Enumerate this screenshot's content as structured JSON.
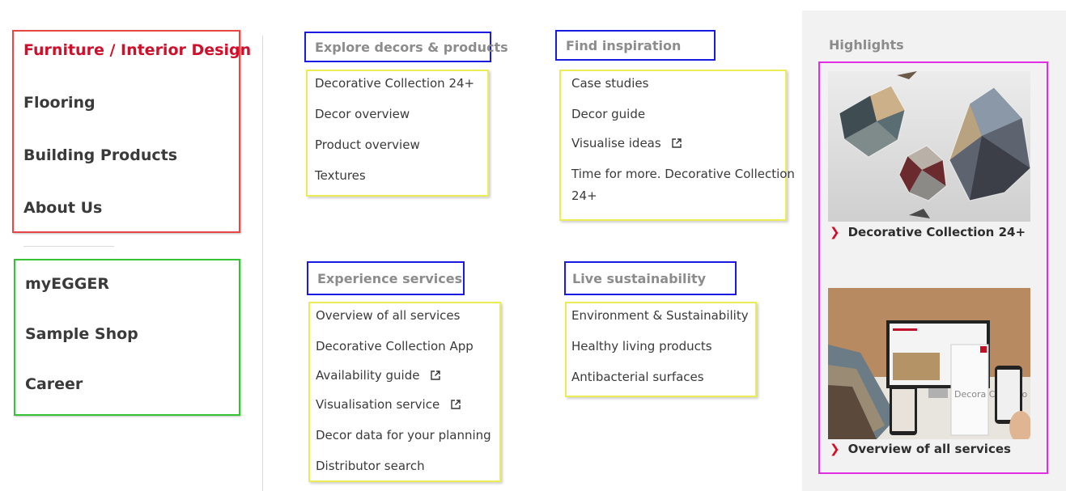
{
  "main_nav": {
    "items": [
      {
        "label": "Furniture / Interior Design",
        "active": true
      },
      {
        "label": "Flooring"
      },
      {
        "label": "Building Products"
      },
      {
        "label": "About Us"
      }
    ]
  },
  "secondary_nav": {
    "items": [
      {
        "label": "myEGGER"
      },
      {
        "label": "Sample Shop"
      },
      {
        "label": "Career"
      }
    ]
  },
  "sections": {
    "explore": {
      "heading": "Explore decors & products",
      "links": [
        "Decorative Collection 24+",
        "Decor overview",
        "Product overview",
        "Textures"
      ]
    },
    "inspiration": {
      "heading": "Find inspiration",
      "links": [
        "Case studies",
        "Decor guide",
        "Visualise ideas",
        "Time for more. Decorative Collection",
        "24+"
      ]
    },
    "services": {
      "heading": "Experience services",
      "links": [
        "Overview of all services",
        "Decorative Collection App",
        "Availability guide",
        "Visualisation service",
        "Decor data for your planning",
        "Distributor search"
      ]
    },
    "sustainability": {
      "heading": "Live sustainability",
      "links": [
        "Environment & Sustainability",
        "Healthy living products",
        "Antibacterial surfaces"
      ]
    }
  },
  "highlights": {
    "title": "Highlights",
    "cards": [
      {
        "caption": "Decorative Collection 24+"
      },
      {
        "caption": "Overview of all services"
      }
    ],
    "promo_book_text": "Decora Collectio"
  },
  "colors": {
    "accent_red": "#d0102a",
    "heading_grey": "#8c8c8c",
    "panel_bg": "#f2f2f2"
  },
  "icons": {
    "external_link": "external-link-icon",
    "chevron": "chevron-right-icon"
  }
}
